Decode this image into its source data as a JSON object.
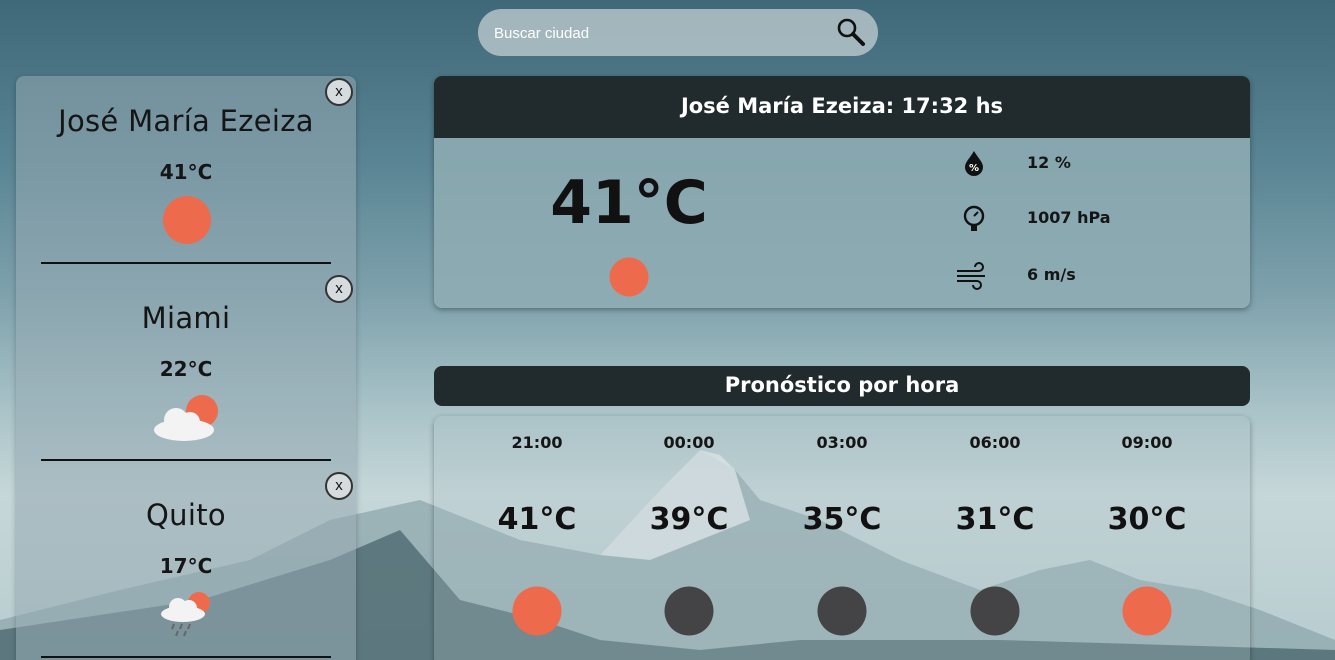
{
  "search": {
    "placeholder": "Buscar ciudad",
    "value": "",
    "icon": "search-icon"
  },
  "sidebar": {
    "close_label": "x",
    "cities": [
      {
        "name": "José María Ezeiza",
        "temp": "41°C",
        "icon": "sun-icon"
      },
      {
        "name": "Miami",
        "temp": "22°C",
        "icon": "partly-cloudy-icon"
      },
      {
        "name": "Quito",
        "temp": "17°C",
        "icon": "rain-cloud-sun-icon"
      }
    ]
  },
  "current": {
    "header": "José María Ezeiza: 17:32 hs",
    "temp": "41°C",
    "icon": "sun-icon",
    "humidity": "12 %",
    "pressure": "1007 hPa",
    "wind": "6 m/s"
  },
  "forecast": {
    "title": "Pronóstico por hora",
    "items": [
      {
        "time": "21:00",
        "temp": "41°C",
        "icon": "sun-icon"
      },
      {
        "time": "00:00",
        "temp": "39°C",
        "icon": "moon-icon"
      },
      {
        "time": "03:00",
        "temp": "35°C",
        "icon": "moon-icon"
      },
      {
        "time": "06:00",
        "temp": "31°C",
        "icon": "moon-icon"
      },
      {
        "time": "09:00",
        "temp": "30°C",
        "icon": "sun-icon"
      }
    ]
  },
  "colors": {
    "sun": "#ed6a4c",
    "moon": "#444446",
    "header_bg": "#212a2c",
    "text": "#151515"
  }
}
